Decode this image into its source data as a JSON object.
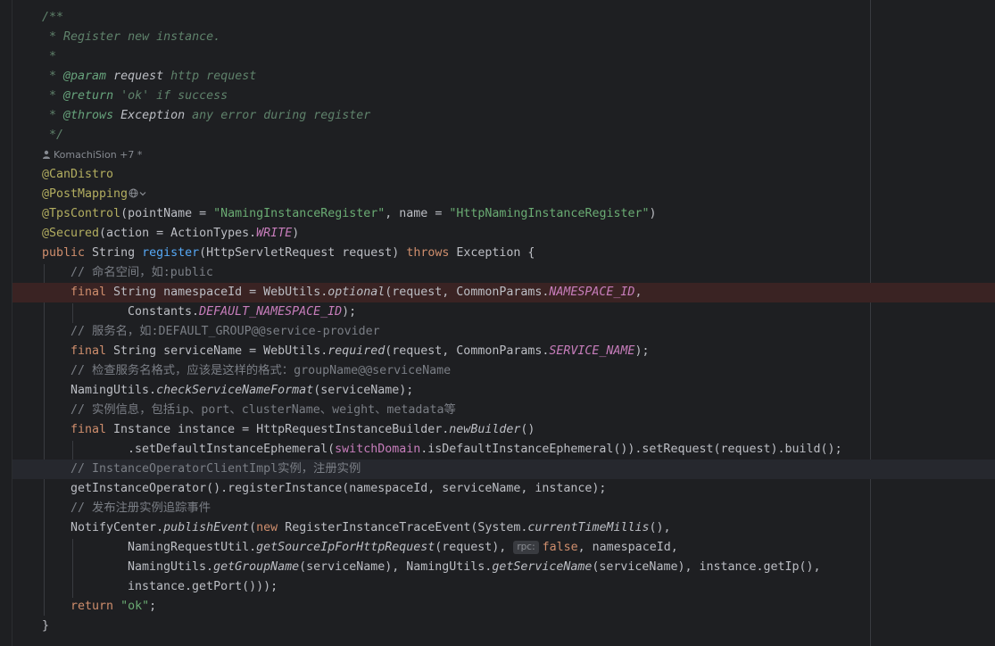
{
  "editor": {
    "doc_open": "/**",
    "doc_desc": " * Register new instance.",
    "doc_blank": " *",
    "doc_param_prefix": " * ",
    "doc_param_tag": "@param",
    "doc_param_name": "request",
    "doc_param_desc": "http request",
    "doc_return_tag": "@return",
    "doc_return_desc": "'ok' if success",
    "doc_throws_tag": "@throws",
    "doc_throws_name": "Exception",
    "doc_throws_desc": "any error during register",
    "doc_close": " */",
    "author_hint": "KomachiSion +7 *",
    "ann_candistro": "@CanDistro",
    "ann_postmapping": "@PostMapping",
    "ann_tps": "@TpsControl",
    "tps_pointname_key": "(pointName = ",
    "tps_pointname_val": "\"NamingInstanceRegister\"",
    "tps_name_key": ", name = ",
    "tps_name_val": "\"HttpNamingInstanceRegister\"",
    "tps_close": ")",
    "ann_secured": "@Secured",
    "secured_open": "(action = ActionTypes.",
    "secured_const": "WRITE",
    "secured_close": ")",
    "sig_public": "public",
    "sig_type": " String ",
    "sig_method": "register",
    "sig_params": "(HttpServletRequest request) ",
    "sig_throws": "throws",
    "sig_tail": " Exception {",
    "c1": "// 命名空间，如:public",
    "l1_final": "final",
    "l1_a": " String namespaceId = WebUtils.",
    "l1_fn": "optional",
    "l1_b": "(request, CommonParams.",
    "l1_const": "NAMESPACE_ID",
    "l1_c": ",",
    "l2_a": "Constants.",
    "l2_const": "DEFAULT_NAMESPACE_ID",
    "l2_b": ");",
    "c2": "// 服务名，如:DEFAULT_GROUP@@service-provider",
    "l3_final": "final",
    "l3_a": " String serviceName = WebUtils.",
    "l3_fn": "required",
    "l3_b": "(request, CommonParams.",
    "l3_const": "SERVICE_NAME",
    "l3_c": ");",
    "c3": "// 检查服务名格式，应该是这样的格式：groupName@@serviceName",
    "l4_a": "NamingUtils.",
    "l4_fn": "checkServiceNameFormat",
    "l4_b": "(serviceName);",
    "c4": "// 实例信息，包括ip、port、clusterName、weight、metadata等",
    "l5_final": "final",
    "l5_a": " Instance instance = HttpRequestInstanceBuilder.",
    "l5_fn": "newBuilder",
    "l5_b": "()",
    "l6_a": ".setDefaultInstanceEphemeral(",
    "l6_field": "switchDomain",
    "l6_b": ".isDefaultInstanceEphemeral()).setRequest(request).build();",
    "c5": "// InstanceOperatorClientImpl实例，注册实例",
    "l7": "getInstanceOperator().registerInstance(namespaceId, serviceName, instance);",
    "c6": "// 发布注册实例追踪事件",
    "l8_a": "NotifyCenter.",
    "l8_fn": "publishEvent",
    "l8_b": "(",
    "l8_new": "new",
    "l8_c": " RegisterInstanceTraceEvent(System.",
    "l8_fn2": "currentTimeMillis",
    "l8_d": "(),",
    "l9_a": "NamingRequestUtil.",
    "l9_fn": "getSourceIpForHttpRequest",
    "l9_b": "(request), ",
    "l9_hint": "rpc:",
    "l9_false": "false",
    "l9_c": ", namespaceId,",
    "l10_a": "NamingUtils.",
    "l10_fn": "getGroupName",
    "l10_b": "(serviceName), NamingUtils.",
    "l10_fn2": "getServiceName",
    "l10_c": "(serviceName), instance.getIp(),",
    "l11": "instance.getPort()));",
    "l12_return": "return",
    "l12_str": "\"ok\"",
    "l12_end": ";",
    "close_brace": "}"
  },
  "icons": [
    "person-icon",
    "globe-icon",
    "chevron-down-icon"
  ]
}
